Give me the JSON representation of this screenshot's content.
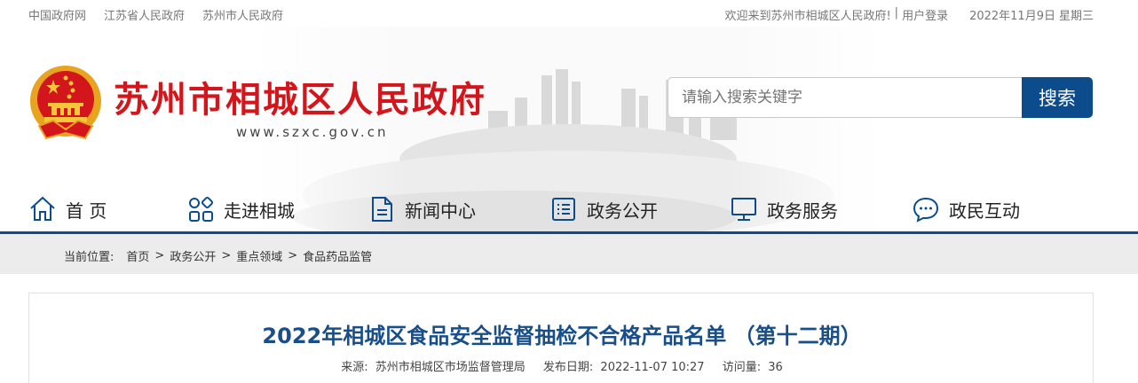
{
  "topbar": {
    "links": [
      "中国政府网",
      "江苏省人民政府",
      "苏州市人民政府"
    ],
    "welcome": "欢迎来到苏州市相城区人民政府!",
    "separator": "|",
    "login": "用户登录",
    "date": "2022年11月9日",
    "weekday": "星期三"
  },
  "header": {
    "title": "苏州市相城区人民政府",
    "url": "www.szxc.gov.cn"
  },
  "search": {
    "placeholder": "请输入搜索关键字",
    "button": "搜索"
  },
  "nav": {
    "items": [
      {
        "label": "首 页",
        "icon": "home-icon"
      },
      {
        "label": "走进相城",
        "icon": "grid-icon"
      },
      {
        "label": "新闻中心",
        "icon": "document-icon"
      },
      {
        "label": "政务公开",
        "icon": "list-icon"
      },
      {
        "label": "政务服务",
        "icon": "monitor-icon"
      },
      {
        "label": "政民互动",
        "icon": "chat-icon"
      }
    ],
    "accent": "#0d4c8c"
  },
  "breadcrumb": {
    "label": "当前位置:",
    "items": [
      "首页",
      "政务公开",
      "重点领域",
      "食品药品监管"
    ],
    "separator": ">"
  },
  "article": {
    "title": "2022年相城区食品安全监督抽检不合格产品名单 （第十二期）",
    "source_label": "来源:",
    "source": "苏州市相城区市场监督管理局",
    "date_label": "发布日期:",
    "date": "2022-11-07 10:27",
    "views_label": "访问量:",
    "views": "36"
  },
  "colors": {
    "brand_red": "#d3161b",
    "brand_blue": "#0d4c8c",
    "title_blue": "#184f8a"
  }
}
